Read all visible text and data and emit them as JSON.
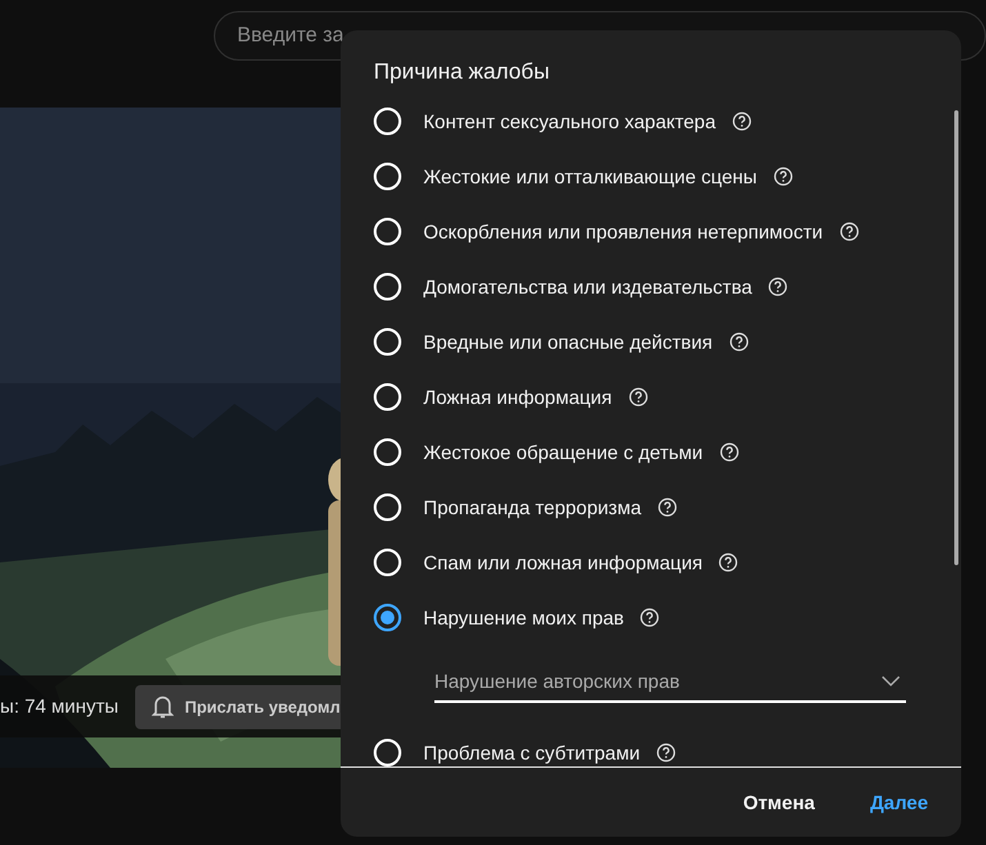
{
  "search": {
    "placeholder": "Введите за"
  },
  "video_bar": {
    "duration_text": "ы: 74 минуты",
    "notify_button": "Прислать уведомл"
  },
  "dialog": {
    "title": "Причина жалобы",
    "options": [
      {
        "kind": "radio",
        "label": "Контент сексуального характера",
        "selected": false
      },
      {
        "kind": "radio",
        "label": "Жестокие или отталкивающие сцены",
        "selected": false
      },
      {
        "kind": "radio",
        "label": "Оскорбления или проявления нетерпимости",
        "selected": false
      },
      {
        "kind": "radio",
        "label": "Домогательства или издевательства",
        "selected": false
      },
      {
        "kind": "radio",
        "label": "Вредные или опасные действия",
        "selected": false
      },
      {
        "kind": "radio",
        "label": "Ложная информация",
        "selected": false
      },
      {
        "kind": "radio",
        "label": "Жестокое обращение с детьми",
        "selected": false
      },
      {
        "kind": "radio",
        "label": "Пропаганда терроризма",
        "selected": false
      },
      {
        "kind": "radio",
        "label": "Спам или ложная информация",
        "selected": false
      },
      {
        "kind": "radio",
        "label": "Нарушение моих прав",
        "selected": true
      },
      {
        "kind": "select",
        "value": "Нарушение авторских прав"
      },
      {
        "kind": "radio",
        "label": "Проблема с субтитрами",
        "selected": false
      }
    ],
    "buttons": [
      {
        "kind": "cancel",
        "label": "Отмена"
      },
      {
        "kind": "next",
        "label": "Далее"
      }
    ]
  }
}
